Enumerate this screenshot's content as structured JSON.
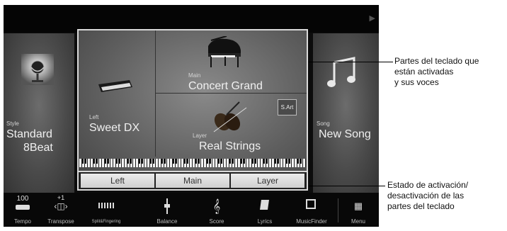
{
  "style": {
    "caption": "Style",
    "name": "Standard",
    "name2": "8Beat"
  },
  "left": {
    "caption": "Left",
    "voice": "Sweet DX"
  },
  "main": {
    "caption": "Main",
    "voice": "Concert Grand"
  },
  "layer": {
    "caption": "Layer",
    "voice": "Real Strings",
    "badge": "S.Art"
  },
  "song": {
    "caption": "Song",
    "name": "New Song"
  },
  "part_buttons": [
    "Left",
    "Main",
    "Layer"
  ],
  "toolbar": {
    "tempo_value": "100",
    "transpose_value": "+1",
    "items": [
      "Tempo",
      "Transpose",
      "Split&Fingering",
      "Balance",
      "Score",
      "Lyrics",
      "MusicFinder",
      "Menu"
    ]
  },
  "callouts": {
    "top": [
      "Partes del teclado que",
      "están activadas",
      "y sus voces"
    ],
    "bottom": [
      "Estado de activación/",
      "desactivación de las",
      "partes del teclado"
    ]
  },
  "icons": {
    "play_arrow": "triangle-right-icon",
    "left_arrow": "triangle-left-icon",
    "style": "microphone-icon",
    "song": "music-note-icon",
    "score": "treble-clef-icon",
    "menu": "grid-icon"
  }
}
